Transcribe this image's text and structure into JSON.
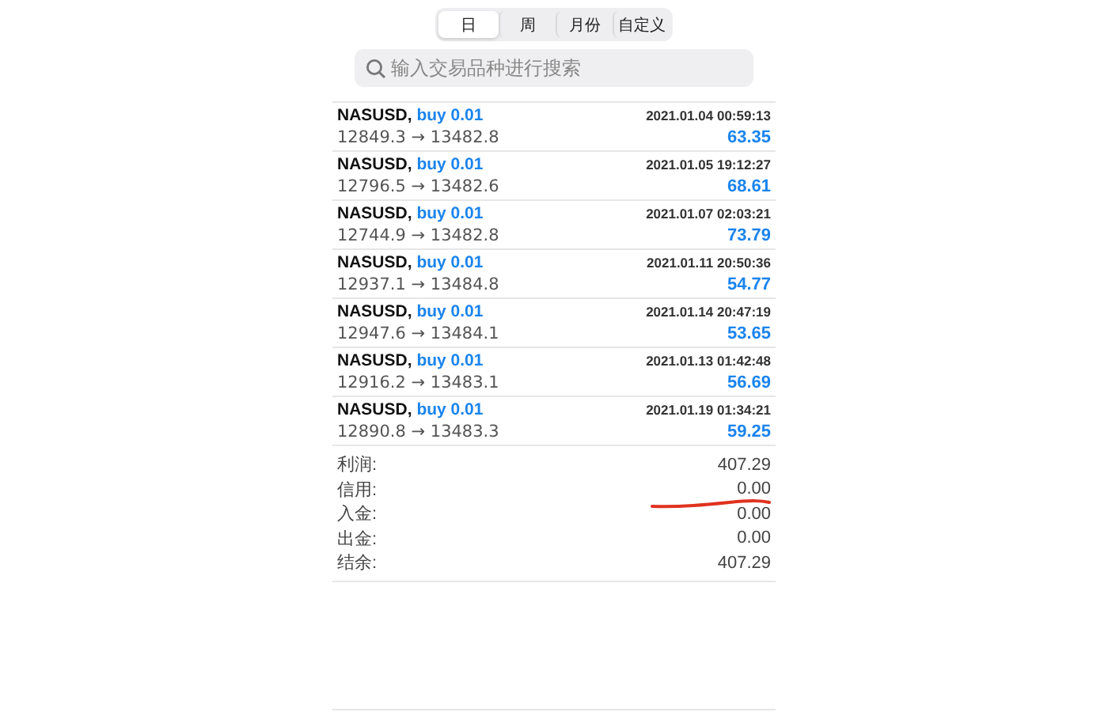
{
  "period_tabs": [
    {
      "label": "日",
      "selected": true
    },
    {
      "label": "周",
      "selected": false
    },
    {
      "label": "月份",
      "selected": false
    },
    {
      "label": "自定义",
      "selected": false
    }
  ],
  "search": {
    "placeholder": "输入交易品种进行搜索"
  },
  "trades": [
    {
      "symbol": "NASUSD,",
      "action": "buy 0.01",
      "time": "2021.01.04 00:59:13",
      "prices": "12849.3 → 13482.8",
      "profit": "63.35"
    },
    {
      "symbol": "NASUSD,",
      "action": "buy 0.01",
      "time": "2021.01.05 19:12:27",
      "prices": "12796.5 → 13482.6",
      "profit": "68.61"
    },
    {
      "symbol": "NASUSD,",
      "action": "buy 0.01",
      "time": "2021.01.07 02:03:21",
      "prices": "12744.9 → 13482.8",
      "profit": "73.79"
    },
    {
      "symbol": "NASUSD,",
      "action": "buy 0.01",
      "time": "2021.01.11 20:50:36",
      "prices": "12937.1 → 13484.8",
      "profit": "54.77"
    },
    {
      "symbol": "NASUSD,",
      "action": "buy 0.01",
      "time": "2021.01.14 20:47:19",
      "prices": "12947.6 → 13484.1",
      "profit": "53.65"
    },
    {
      "symbol": "NASUSD,",
      "action": "buy 0.01",
      "time": "2021.01.13 01:42:48",
      "prices": "12916.2 → 13483.1",
      "profit": "56.69"
    },
    {
      "symbol": "NASUSD,",
      "action": "buy 0.01",
      "time": "2021.01.19 01:34:21",
      "prices": "12890.8 → 13483.3",
      "profit": "59.25"
    }
  ],
  "summary": [
    {
      "label": "利润:",
      "value": "407.29",
      "underlined": false
    },
    {
      "label": "信用:",
      "value": "0.00",
      "underlined": true
    },
    {
      "label": "入金:",
      "value": "0.00",
      "underlined": false
    },
    {
      "label": "出金:",
      "value": "0.00",
      "underlined": false
    },
    {
      "label": "结余:",
      "value": "407.29",
      "underlined": false
    }
  ]
}
